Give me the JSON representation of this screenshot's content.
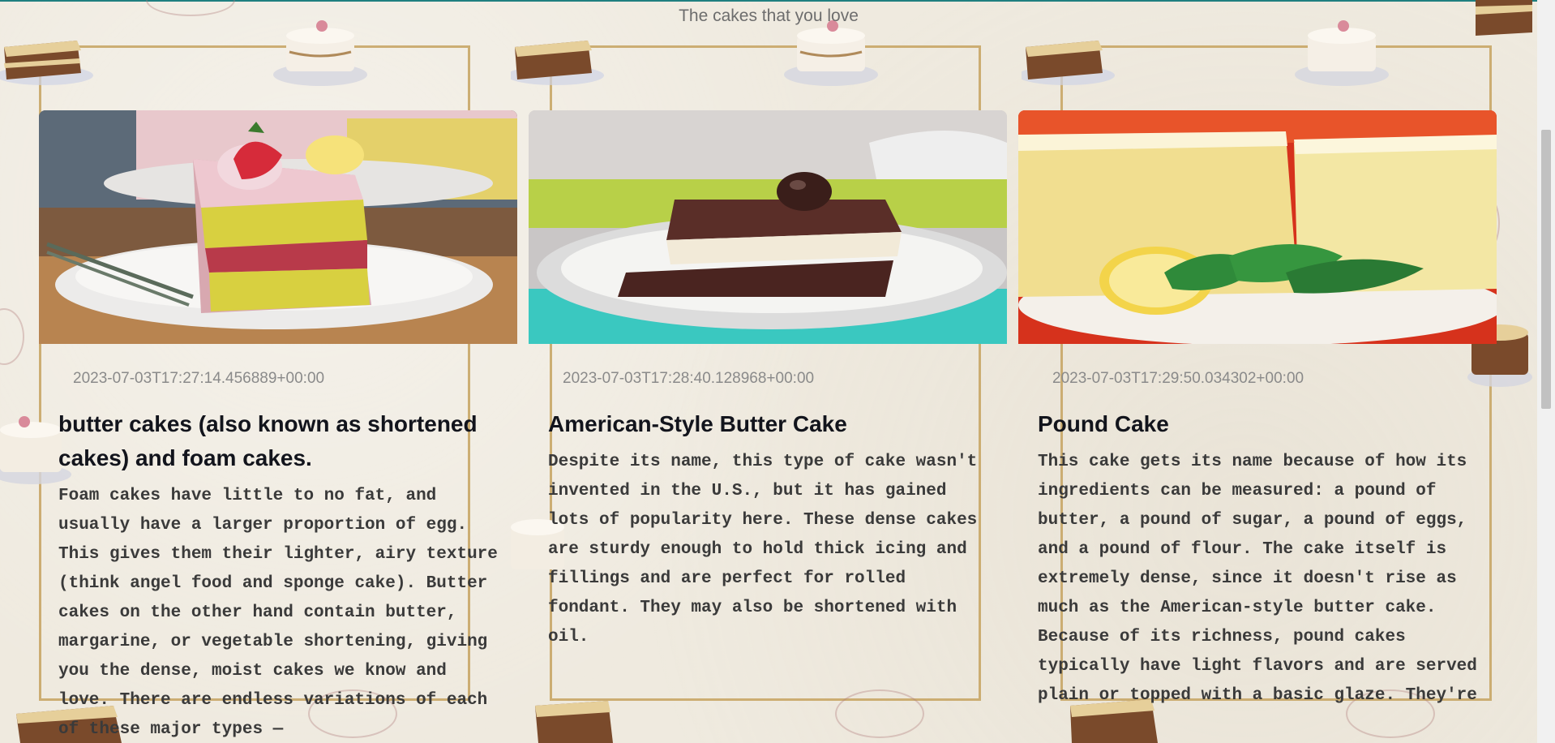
{
  "page": {
    "subtitle": "The cakes that you love"
  },
  "colors": {
    "accent_top": "#1f7f80",
    "frame_gold": "#c6a25f",
    "title": "#12141c",
    "body": "#3a3a3a",
    "date": "#8a8a8a"
  },
  "cards": [
    {
      "image_icon": "strawberry-layer-cake-photo",
      "date": "2023-07-03T17:27:14.456889+00:00",
      "title": "butter cakes (also known as shortened cakes) and foam cakes.",
      "body": "Foam cakes have little to no fat, and usually have a larger proportion of egg. This gives them their lighter, airy texture (think angel food and sponge cake). Butter cakes on the other hand contain butter, margarine, or vegetable shortening, giving you the dense, moist cakes we know and love. There are endless variations of each of these major types —"
    },
    {
      "image_icon": "chocolate-cake-photo",
      "date": "2023-07-03T17:28:40.128968+00:00",
      "title": "American-Style Butter Cake",
      "body": "Despite its name, this type of cake wasn't invented in the U.S., but it has gained lots of popularity here. These dense cakes are sturdy enough to hold thick icing and fillings and are perfect for rolled fondant. They may also be shortened with oil."
    },
    {
      "image_icon": "pound-cake-photo",
      "date": "2023-07-03T17:29:50.034302+00:00",
      "title": "Pound Cake",
      "body": "This cake gets its name because of how its ingredients can be measured: a pound of butter, a pound of sugar, a pound of eggs, and a pound of flour. The cake itself is extremely dense, since it doesn't rise as much as the American-style butter cake. Because of its richness, pound cakes typically have light flavors and are served plain or topped with a basic glaze. They're"
    }
  ]
}
